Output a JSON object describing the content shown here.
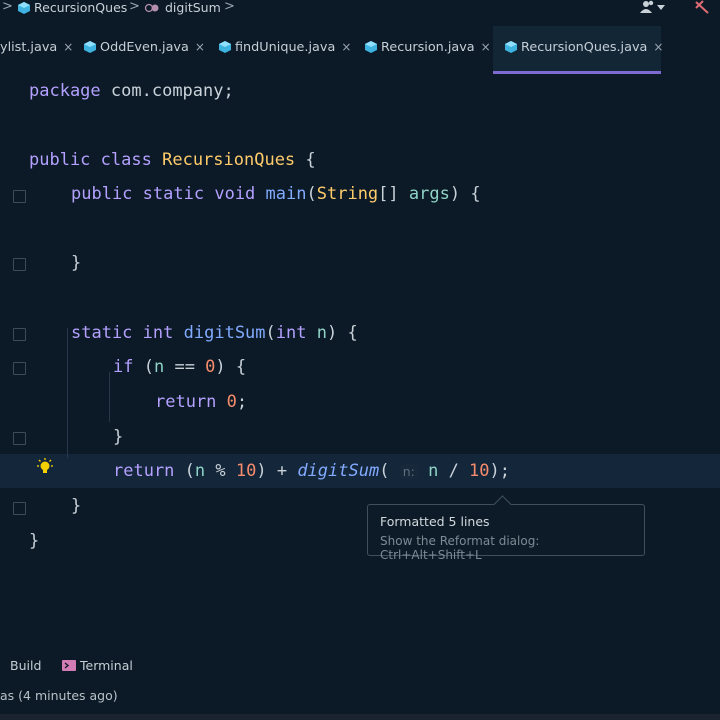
{
  "breadcrumb": {
    "items": [
      {
        "label": "RecursionQues"
      },
      {
        "label": "digitSum"
      }
    ]
  },
  "tabs": [
    {
      "label": "ylist.java",
      "active": false
    },
    {
      "label": "OddEven.java",
      "active": false
    },
    {
      "label": "findUnique.java",
      "active": false
    },
    {
      "label": "Recursion.java",
      "active": false
    },
    {
      "label": "RecursionQues.java",
      "active": true
    }
  ],
  "tab_close_glyph": "×",
  "code": {
    "package_kw": "package",
    "package_name": "com.company;",
    "public_kw": "public",
    "class_kw": "class",
    "class_name": "RecursionQues",
    "static_kw": "static",
    "void_kw": "void",
    "main_fn": "main",
    "string_type": "String",
    "args_param": "args",
    "int_kw": "int",
    "digitsum_fn": "digitSum",
    "n_param": "n",
    "if_kw": "if",
    "return_kw": "return",
    "zero": "0",
    "ten": "10",
    "param_hint": "n:",
    "open_brace": "{",
    "close_brace": "}"
  },
  "tooltip": {
    "title": "Formatted 5 lines",
    "subtitle": "Show the Reformat dialog: Ctrl+Alt+Shift+L"
  },
  "bottom_bar": {
    "build_label": "Build",
    "terminal_label": "Terminal"
  },
  "status_text": "as (4 minutes ago)",
  "colors": {
    "background": "#0b1a26",
    "active_tab_underline": "#7f6ad1",
    "keyword": "#c792ea",
    "function": "#82aaff",
    "type": "#ffcb6b",
    "number": "#f78c6c",
    "bulb": "#f5d000"
  },
  "icons": [
    "class-cube-icon",
    "method-icon",
    "user-menu-icon",
    "pin-icon",
    "lightbulb-icon",
    "terminal-icon",
    "fold-icon"
  ]
}
